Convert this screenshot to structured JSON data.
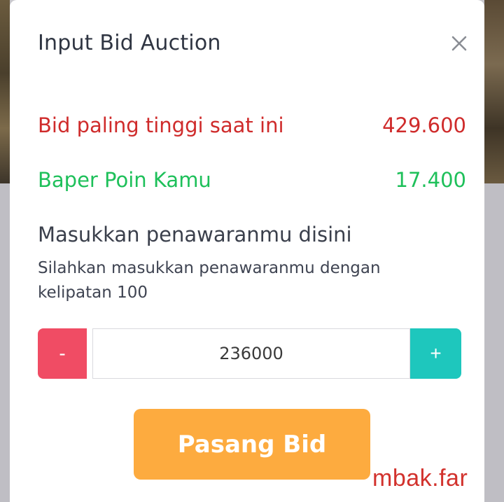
{
  "modal": {
    "title": "Input Bid Auction"
  },
  "summary": {
    "highest_bid_label": "Bid paling tinggi saat ini",
    "highest_bid_value": "429.600",
    "points_label": "Baper Poin Kamu",
    "points_value": "17.400"
  },
  "bid_form": {
    "section_title": "Masukkan penawaranmu disini",
    "helper_text": "Silahkan masukkan penawaranmu dengan kelipatan 100",
    "decrement_label": "-",
    "amount_value": "236000",
    "increment_label": "+",
    "submit_label": "Pasang Bid"
  },
  "watermark": "mbak.far",
  "colors": {
    "highest_bid": "#cf2b2b",
    "points": "#1ec05a",
    "decrement_button": "#f04c64",
    "increment_button": "#1ec7bd",
    "submit_button": "#fdab3f",
    "watermark": "#d2322d"
  },
  "icons": {
    "close": "close-icon"
  }
}
